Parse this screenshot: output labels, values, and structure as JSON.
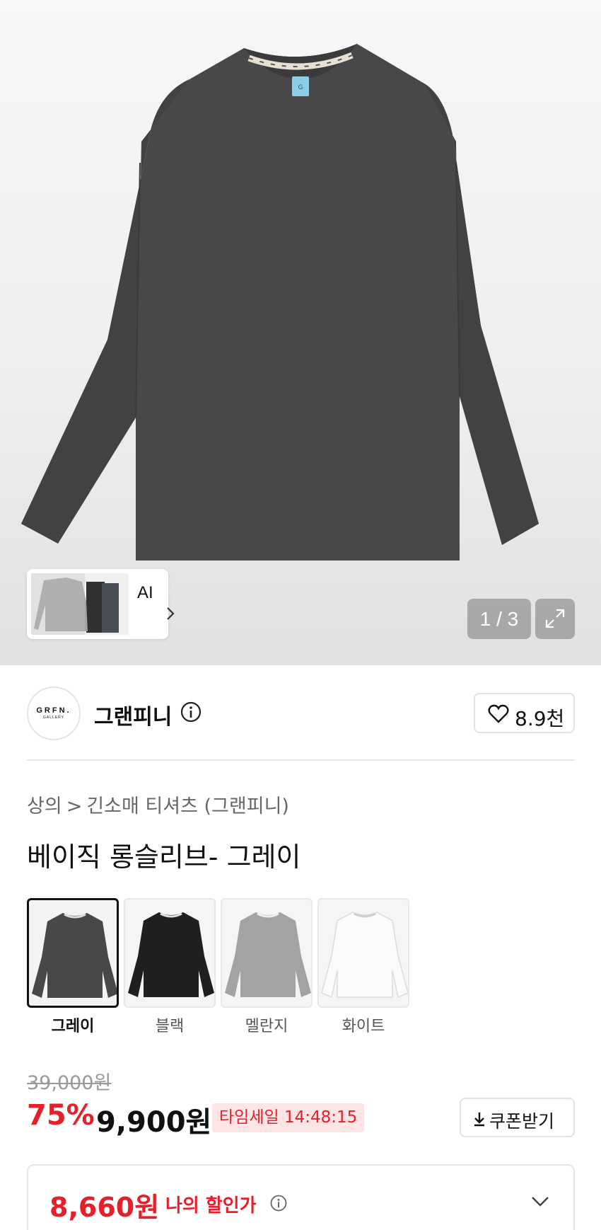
{
  "gallery": {
    "pager_current": "1",
    "pager_total": "3",
    "ai_label": "AI"
  },
  "brand": {
    "logo_text": "GRFN.",
    "logo_sub": "GALLERY",
    "name": "그랜피니",
    "like_count": "8.9천"
  },
  "breadcrumb": {
    "category": "상의",
    "subcategory": "긴소매 티셔츠 (그랜피니)"
  },
  "product": {
    "title": "베이직 롱슬리브- 그레이"
  },
  "colors": {
    "options": [
      {
        "label": "그레이",
        "hex": "#48484a",
        "selected": true
      },
      {
        "label": "블랙",
        "hex": "#1f1f1f",
        "selected": false
      },
      {
        "label": "멜란지",
        "hex": "#a3a3a3",
        "selected": false
      },
      {
        "label": "화이트",
        "hex": "#f9f9f9",
        "selected": false
      }
    ]
  },
  "price": {
    "original": "39,000원",
    "discount_rate": "75%",
    "sale": "9,900원",
    "timesale_label": "타임세일",
    "timesale_time": "14:48:15",
    "coupon_button": "쿠폰받기"
  },
  "my_discount": {
    "price": "8,660원",
    "label": "나의 할인가"
  },
  "theme": {
    "accent_red": "#e5202b",
    "timesale_bg": "#fde5e6"
  }
}
